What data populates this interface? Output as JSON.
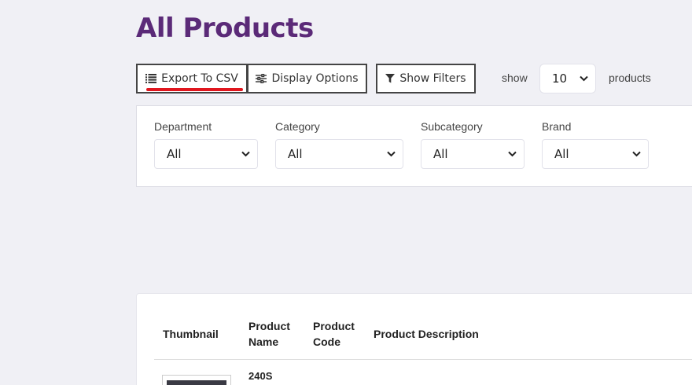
{
  "page": {
    "title": "All Products"
  },
  "toolbar": {
    "export_label": "Export To CSV",
    "display_label": "Display Options",
    "filters_label": "Show Filters",
    "show_label": "show",
    "per_page_value": "10",
    "products_label": "products"
  },
  "filters": [
    {
      "label": "Department",
      "value": "All"
    },
    {
      "label": "Category",
      "value": "All"
    },
    {
      "label": "Subcategory",
      "value": "All"
    },
    {
      "label": "Brand",
      "value": "All"
    }
  ],
  "table": {
    "headers": {
      "thumbnail": "Thumbnail",
      "product_name_1": "Product",
      "product_name_2": "Name",
      "product_code_1": "Product",
      "product_code_2": "Code",
      "description": "Product Description"
    },
    "rows": [
      {
        "name": "240S"
      }
    ]
  },
  "colors": {
    "title": "#5b2a78",
    "accent_underline": "#e0161e",
    "background": "#f0f0f5"
  },
  "icons": {
    "export": "list-icon",
    "display": "sliders-icon",
    "filters": "filter-icon",
    "select": "chevron-down-icon"
  }
}
